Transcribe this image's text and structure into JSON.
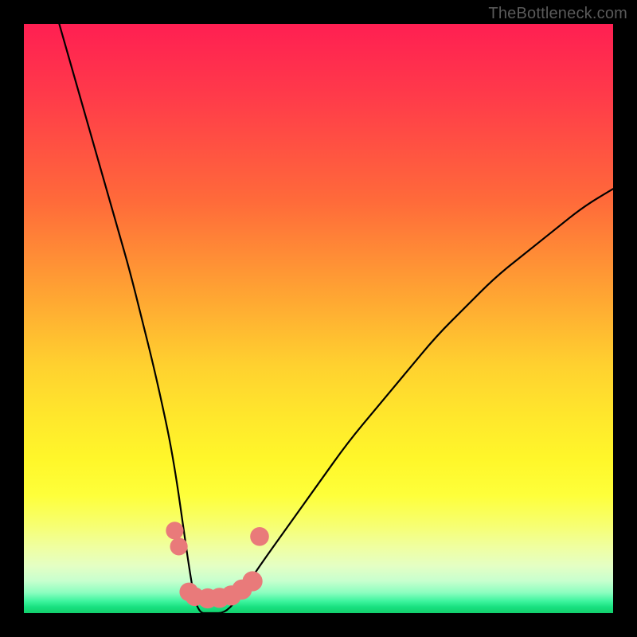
{
  "watermark": "TheBottleneck.com",
  "chart_data": {
    "type": "line",
    "title": "",
    "xlabel": "",
    "ylabel": "",
    "xlim": [
      0,
      100
    ],
    "ylim": [
      0,
      100
    ],
    "grid": false,
    "series": [
      {
        "name": "bottleneck-curve",
        "color": "#000000",
        "x": [
          6,
          8,
          10,
          12,
          14,
          16,
          18,
          20,
          22,
          24,
          25,
          26,
          27,
          28,
          29,
          30,
          31,
          32,
          34,
          36,
          40,
          45,
          50,
          55,
          60,
          65,
          70,
          75,
          80,
          85,
          90,
          95,
          100
        ],
        "y": [
          100,
          93,
          86,
          79,
          72,
          65,
          58,
          50,
          42,
          33,
          28,
          22,
          15,
          8,
          2,
          0,
          0,
          0,
          0,
          2,
          8,
          15,
          22,
          29,
          35,
          41,
          47,
          52,
          57,
          61,
          65,
          69,
          72
        ]
      }
    ],
    "markers": [
      {
        "name": "dot-left-upper",
        "color": "#e97a7a",
        "x": 25.6,
        "y": 14.0,
        "r": 1.5
      },
      {
        "name": "dot-left-lower",
        "color": "#e97a7a",
        "x": 26.3,
        "y": 11.3,
        "r": 1.5
      },
      {
        "name": "blob-left-a",
        "color": "#e97a7a",
        "x": 28.0,
        "y": 3.6,
        "r": 1.6
      },
      {
        "name": "blob-left-b",
        "color": "#e97a7a",
        "x": 29.0,
        "y": 2.8,
        "r": 1.6
      },
      {
        "name": "blob-mid-a",
        "color": "#e97a7a",
        "x": 31.2,
        "y": 2.5,
        "r": 1.7
      },
      {
        "name": "blob-mid-b",
        "color": "#e97a7a",
        "x": 33.2,
        "y": 2.6,
        "r": 1.7
      },
      {
        "name": "blob-mid-c",
        "color": "#e97a7a",
        "x": 35.2,
        "y": 3.0,
        "r": 1.7
      },
      {
        "name": "blob-right-a",
        "color": "#e97a7a",
        "x": 37.0,
        "y": 4.0,
        "r": 1.7
      },
      {
        "name": "blob-right-b",
        "color": "#e97a7a",
        "x": 38.8,
        "y": 5.4,
        "r": 1.7
      },
      {
        "name": "dot-right-upper",
        "color": "#e97a7a",
        "x": 40.0,
        "y": 13.0,
        "r": 1.6
      }
    ]
  }
}
